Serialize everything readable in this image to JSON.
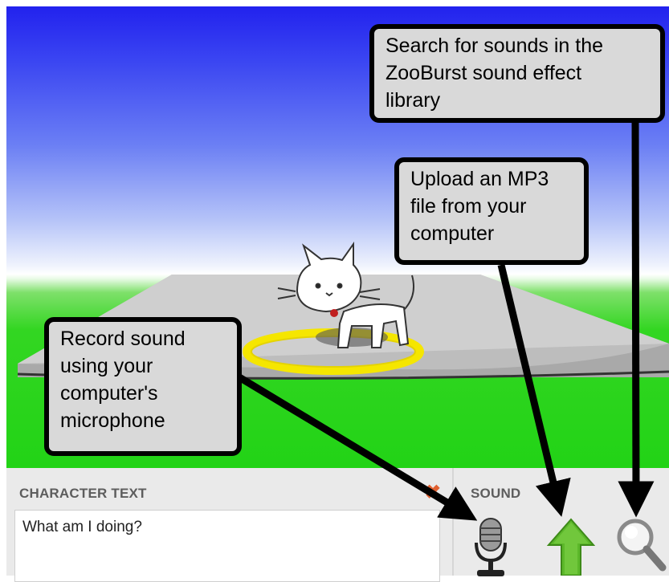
{
  "callouts": {
    "search": [
      "Search for sounds in the",
      "ZooBurst sound effect",
      "library"
    ],
    "upload": [
      "Upload an MP3",
      "file from your",
      "computer"
    ],
    "record": [
      "Record sound",
      "using your",
      "computer's",
      "microphone"
    ]
  },
  "panel": {
    "character_title": "CHARACTER TEXT",
    "character_text": "What am I doing?",
    "sound_title": "SOUND",
    "close_symbol": "✖"
  },
  "icons": [
    "microphone-icon",
    "upload-arrow-icon",
    "magnifier-icon"
  ],
  "colors": {
    "callout_bg": "#d9d9d9",
    "ring": "#f5e600",
    "ground": "#22d316",
    "sky_top": "#2222ee",
    "upload_green": "#5cb82a"
  }
}
